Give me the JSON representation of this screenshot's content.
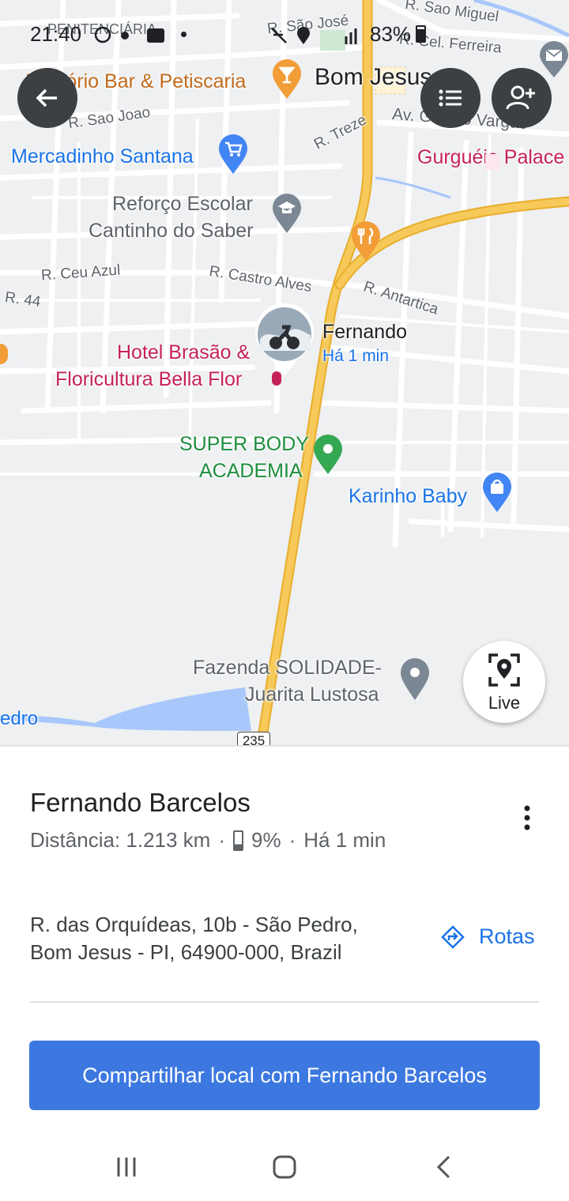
{
  "status_bar": {
    "time": "21:40",
    "battery_percent": "83%"
  },
  "map": {
    "streets": [
      {
        "id": "sao-miguel",
        "text": "R. Sao Miguel"
      },
      {
        "id": "sao-jose",
        "text": "R. São José"
      },
      {
        "id": "cel-ferreira",
        "text": "R. Cel. Ferreira"
      },
      {
        "id": "sao-joao",
        "text": "R. Sao Joao"
      },
      {
        "id": "treze",
        "text": "R. Treze"
      },
      {
        "id": "getulio",
        "text": "Av. Getulio Vargas"
      },
      {
        "id": "ceu-azul",
        "text": "R. Ceu Azul"
      },
      {
        "id": "castro-alves",
        "text": "R. Castro Alves"
      },
      {
        "id": "antartica",
        "text": "R. Antartica"
      },
      {
        "id": "r44",
        "text": "R. 44"
      },
      {
        "id": "penitenciaria",
        "text": "PENITENCIÁRIA"
      },
      {
        "id": "pedro",
        "text": "edro"
      }
    ],
    "places": {
      "emporio": "Empório Bar & Petiscaria",
      "bom_jesus": "Bom Jesus",
      "mercadinho": "Mercadinho Santana",
      "gurgueia": "Gurguéia Palace",
      "reforco_line1": "Reforço Escolar",
      "reforco_line2": "Cantinho do Saber",
      "hotel_line1": "Hotel Brasão &",
      "hotel_line2": "Floricultura Bella Flor",
      "super_body_line1": "SUPER BODY",
      "super_body_line2": "ACADEMIA",
      "karinho": "Karinho Baby",
      "fazenda_line1": "Fazenda SOLIDADE-",
      "fazenda_line2": "Juarita Lustosa",
      "route_shield": "235"
    },
    "person_marker": {
      "name": "Fernando",
      "time": "Há 1 min"
    },
    "live_button_label": "Live",
    "colors": {
      "highway": "#f6c95a",
      "highway_edge": "#e8ae2c",
      "water": "#a8c7fa",
      "map_bg": "#eef0f2",
      "street": "#ffffff"
    }
  },
  "sheet": {
    "person_name": "Fernando Barcelos",
    "distance": "Distância: 1.213 km",
    "battery": "9%",
    "last_seen": "Há 1 min",
    "address_line1": "R. das Orquídeas, 10b - São Pedro,",
    "address_line2": "Bom Jesus - PI, 64900-000, Brazil",
    "directions_label": "Rotas",
    "share_button_label": "Compartilhar local com Fernando Barcelos",
    "accent_color": "#1a73e8"
  }
}
